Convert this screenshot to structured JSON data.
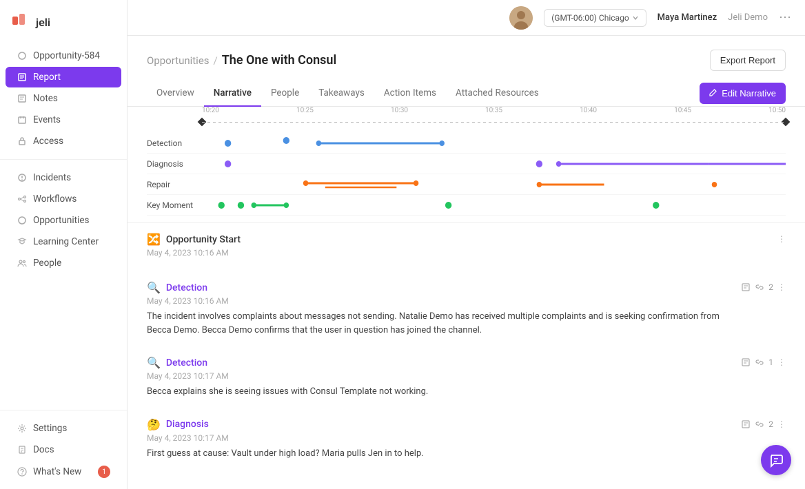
{
  "app": {
    "logo": "jeli",
    "logo_icon": "🔴"
  },
  "sidebar": {
    "top_item": {
      "label": "Opportunity-584",
      "icon": "○"
    },
    "nav_items": [
      {
        "id": "report",
        "label": "Report",
        "active": true,
        "icon": "□"
      },
      {
        "id": "notes",
        "label": "Notes",
        "icon": "📝"
      },
      {
        "id": "events",
        "label": "Events",
        "icon": "📅"
      },
      {
        "id": "access",
        "label": "Access",
        "icon": "🔒"
      }
    ],
    "main_items": [
      {
        "id": "incidents",
        "label": "Incidents",
        "icon": "○"
      },
      {
        "id": "workflows",
        "label": "Workflows",
        "icon": "○"
      },
      {
        "id": "opportunities",
        "label": "Opportunities",
        "icon": "○"
      },
      {
        "id": "learning-center",
        "label": "Learning Center",
        "icon": "○"
      },
      {
        "id": "people",
        "label": "People",
        "icon": "○"
      }
    ],
    "bottom_items": [
      {
        "id": "settings",
        "label": "Settings",
        "icon": "⚙"
      },
      {
        "id": "docs",
        "label": "Docs",
        "icon": "📄"
      },
      {
        "id": "whats-new",
        "label": "What's New",
        "icon": "🔔",
        "badge": 1
      }
    ]
  },
  "topbar": {
    "timezone": "(GMT-06:00) Chicago",
    "user_name": "Maya Martinez",
    "org_name": "Jeli Demo"
  },
  "page": {
    "breadcrumb_link": "Opportunities",
    "breadcrumb_sep": "/",
    "title": "The One with Consul",
    "export_btn": "Export Report"
  },
  "tabs": [
    {
      "id": "overview",
      "label": "Overview",
      "active": false
    },
    {
      "id": "narrative",
      "label": "Narrative",
      "active": true
    },
    {
      "id": "people",
      "label": "People",
      "active": false
    },
    {
      "id": "takeaways",
      "label": "Takeaways",
      "active": false
    },
    {
      "id": "action-items",
      "label": "Action Items",
      "active": false
    },
    {
      "id": "attached-resources",
      "label": "Attached Resources",
      "active": false
    }
  ],
  "edit_narrative_btn": "Edit Narrative",
  "timeline": {
    "time_labels": [
      "10:20",
      "10:25",
      "10:30",
      "10:35",
      "10:40",
      "10:45",
      "10:50"
    ],
    "rows": [
      {
        "label": "Detection"
      },
      {
        "label": "Diagnosis"
      },
      {
        "label": "Repair"
      },
      {
        "label": "Key Moment"
      }
    ]
  },
  "events": [
    {
      "id": "opportunity-start",
      "icon": "🔀",
      "type": "Opportunity Start",
      "type_color": "black",
      "date": "May 4, 2023 10:16 AM",
      "text": "",
      "links": 0,
      "notes": 0,
      "show_actions": false
    },
    {
      "id": "detection-1",
      "icon": "🔍",
      "type": "Detection",
      "type_color": "purple",
      "date": "May 4, 2023 10:16 AM",
      "text": "The incident involves complaints about messages not sending. Natalie Demo has received multiple complaints and is seeking confirmation from Becca Demo. Becca Demo confirms that the user in question has joined the channel.",
      "links": 2,
      "notes": 1,
      "show_actions": true
    },
    {
      "id": "detection-2",
      "icon": "🔍",
      "type": "Detection",
      "type_color": "purple",
      "date": "May 4, 2023 10:17 AM",
      "text": "Becca explains she is seeing issues with Consul Template not working.",
      "links": 1,
      "notes": 1,
      "show_actions": true
    },
    {
      "id": "diagnosis-1",
      "icon": "🤔",
      "type": "Diagnosis",
      "type_color": "purple",
      "date": "May 4, 2023 10:17 AM",
      "text": "First guess at cause: Vault under high load? Maria pulls Jen in to help.",
      "links": 2,
      "notes": 1,
      "show_actions": true
    }
  ]
}
